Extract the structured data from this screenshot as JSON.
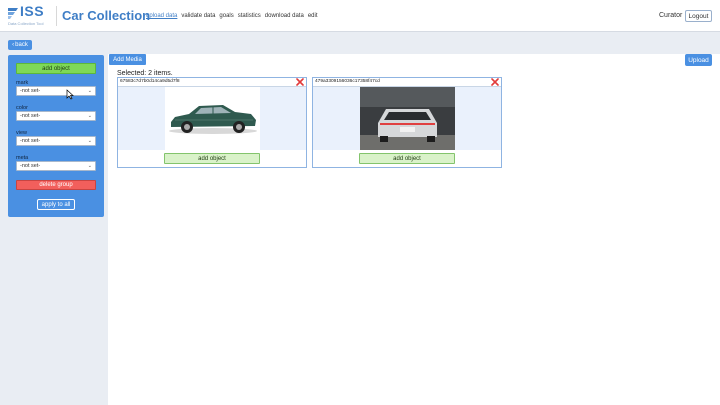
{
  "header": {
    "logo_text": "ISS",
    "logo_tagline": "Data Collection Tool",
    "app_title": "Car Collection",
    "nav": [
      {
        "label": "upload data",
        "active": true
      },
      {
        "label": "validate data",
        "active": false
      },
      {
        "label": "goals",
        "active": false
      },
      {
        "label": "statistics",
        "active": false
      },
      {
        "label": "download data",
        "active": false
      },
      {
        "label": "edit",
        "active": false
      }
    ],
    "user_role": "Curator",
    "logout_label": "Logout"
  },
  "back_label": "back",
  "sidebar": {
    "add_object_label": "add object",
    "fields": [
      {
        "label": "mark",
        "value": "-not set-"
      },
      {
        "label": "color",
        "value": "-not set-"
      },
      {
        "label": "view",
        "value": "-not set-"
      },
      {
        "label": "meta",
        "value": "-not set-"
      }
    ],
    "delete_group_label": "delete group",
    "apply_all_label": "apply to all"
  },
  "main": {
    "add_media_label": "Add Media",
    "upload_label": "Upload",
    "selected_text": "Selected: 2 items.",
    "cards": [
      {
        "id": "67583c7d7b0d14ca9d5d7f8",
        "add_object_label": "add object",
        "photo": "green-sedan-side-view"
      },
      {
        "id": "479a3309156036c17358f47cd",
        "add_object_label": "add object",
        "photo": "silver-sedan-rear-view"
      }
    ]
  },
  "colors": {
    "accent": "#4a90e2",
    "add_green": "#7ed957",
    "delete_red": "#f25f5c",
    "card_border": "#8fb4e2"
  }
}
